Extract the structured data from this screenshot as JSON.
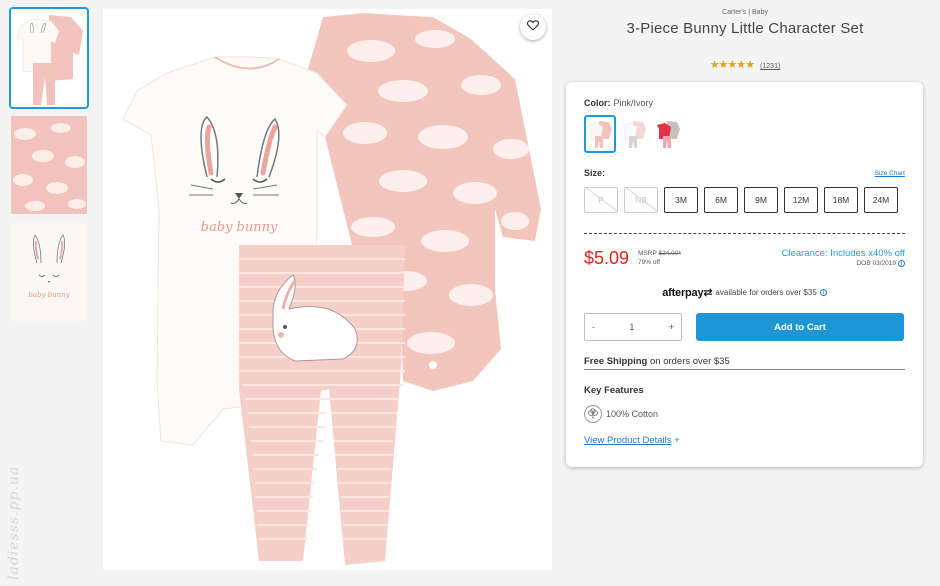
{
  "product": {
    "brand_line": "Carter's | Baby",
    "title": "3-Piece Bunny Little Character Set",
    "stars": "★★★★★",
    "review_count": "(1231)",
    "rating_value": 5
  },
  "thumbnails": [
    {
      "name": "outfit-set",
      "active": true
    },
    {
      "name": "bunny-print-fabric",
      "active": false
    },
    {
      "name": "bunny-face-bodysuit",
      "active": false
    }
  ],
  "color": {
    "label": "Color:",
    "value": "Pink/Ivory"
  },
  "size": {
    "label": "Size:",
    "size_chart": "Size Chart",
    "options": [
      {
        "label": "P",
        "available": false
      },
      {
        "label": "NB",
        "available": false
      },
      {
        "label": "3M",
        "available": true
      },
      {
        "label": "6M",
        "available": true
      },
      {
        "label": "9M",
        "available": true
      },
      {
        "label": "12M",
        "available": true
      },
      {
        "label": "18M",
        "available": true
      },
      {
        "label": "24M",
        "available": true
      }
    ]
  },
  "pricing": {
    "price": "$5.09",
    "msrp_label": "MSRP",
    "msrp_value": "$24.00*",
    "discount": "79% off",
    "clearance": "Clearance: Includes x40% off",
    "dob": "DOB 03/2019"
  },
  "afterpay": {
    "logo": "afterpay",
    "text": "available for orders over $35"
  },
  "quantity": {
    "minus": "-",
    "value": "1",
    "plus": "+"
  },
  "add_to_cart": "Add to Cart",
  "shipping": {
    "bold": "Free Shipping",
    "rest": "on orders over $35"
  },
  "features": {
    "heading": "Key Features",
    "items": [
      "100% Cotton"
    ]
  },
  "view_details": {
    "label": "View Product Details",
    "icon": "+"
  },
  "watermark": "ladiesss.pp.ua",
  "colors": {
    "accent_blue": "#1e96d6",
    "price_red": "#e2231a",
    "clearance_blue": "#1ea1d5",
    "star_gold": "#e0a21c",
    "pink": "#f2c3bc"
  }
}
